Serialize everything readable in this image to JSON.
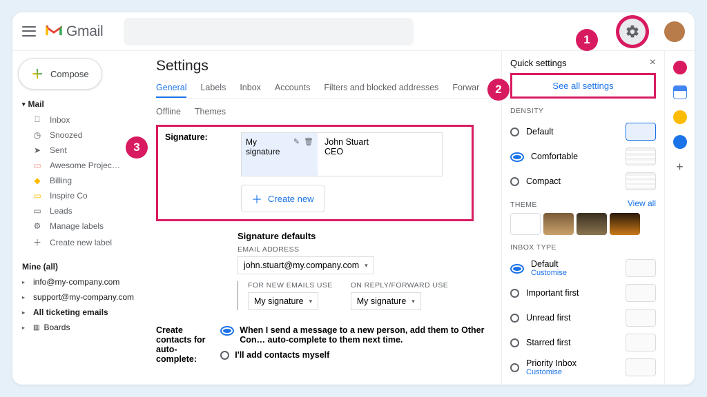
{
  "header": {
    "app_name": "Gmail"
  },
  "markers": {
    "m1": "1",
    "m2": "2",
    "m3": "3"
  },
  "compose": "Compose",
  "sidebar": {
    "mail_head": "Mail",
    "items": [
      {
        "icon": "⎕",
        "label": "Inbox"
      },
      {
        "icon": "◷",
        "label": "Snoozed"
      },
      {
        "icon": "➤",
        "label": "Sent"
      },
      {
        "icon": "▭",
        "label": "Awesome Projec…"
      },
      {
        "icon": "◆",
        "label": "Billing"
      },
      {
        "icon": "▭",
        "label": "Inspire Co"
      },
      {
        "icon": "▭",
        "label": "Leads"
      },
      {
        "icon": "⚙",
        "label": "Manage labels"
      },
      {
        "icon": "＋",
        "label": "Create new label"
      }
    ],
    "mine_head": "Mine (all)",
    "mine": [
      {
        "label": "info@my-company.com",
        "bold": false
      },
      {
        "label": "support@my-company.com",
        "bold": false
      },
      {
        "label": "All ticketing emails",
        "bold": true
      },
      {
        "label": "Boards",
        "bold": false,
        "icon": "▥"
      }
    ]
  },
  "settings": {
    "title": "Settings",
    "tabs": [
      "General",
      "Labels",
      "Inbox",
      "Accounts",
      "Filters and blocked addresses",
      "Forwar"
    ],
    "tabs2": [
      "Offline",
      "Themes"
    ],
    "signature_label": "Signature:",
    "sig_name": "My signature",
    "sig_preview_line1": "John Stuart",
    "sig_preview_line2": "CEO",
    "create_new": "Create new",
    "defaults_title": "Signature defaults",
    "email_label": "EMAIL ADDRESS",
    "email_value": "john.stuart@my.company.com",
    "col1_label": "FOR NEW EMAILS USE",
    "col2_label": "ON REPLY/FORWARD USE",
    "select_value": "My signature",
    "contacts_label": "Create contacts for auto-complete:",
    "contacts_opt1": "When I send a message to a new person, add them to Other Con… auto-complete to them next time.",
    "contacts_opt2": "I'll add contacts myself"
  },
  "quick": {
    "title": "Quick settings",
    "see_all": "See all settings",
    "density": "DENSITY",
    "density_opts": [
      "Default",
      "Comfortable",
      "Compact"
    ],
    "theme": "THEME",
    "view_all": "View all",
    "inbox_type": "INBOX TYPE",
    "inbox_opts": [
      {
        "label": "Default",
        "customise": "Customise"
      },
      {
        "label": "Important first"
      },
      {
        "label": "Unread first"
      },
      {
        "label": "Starred first"
      },
      {
        "label": "Priority Inbox",
        "customise": "Customise"
      }
    ]
  }
}
